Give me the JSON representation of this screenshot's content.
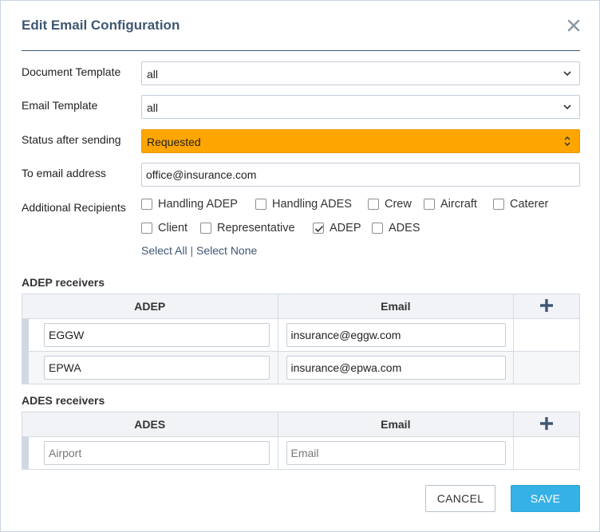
{
  "dialog": {
    "title": "Edit Email Configuration",
    "close_icon": "close-icon"
  },
  "form": {
    "document_template": {
      "label": "Document Template",
      "value": "all"
    },
    "email_template": {
      "label": "Email Template",
      "value": "all"
    },
    "status_after_sending": {
      "label": "Status after sending",
      "value": "Requested",
      "color": "#ffa500"
    },
    "to_email": {
      "label": "To email address",
      "value": "office@insurance.com"
    },
    "additional_recipients": {
      "label": "Additional Recipients",
      "options": [
        {
          "label": "Handling ADEP",
          "checked": false
        },
        {
          "label": "Handling ADES",
          "checked": false
        },
        {
          "label": "Crew",
          "checked": false
        },
        {
          "label": "Aircraft",
          "checked": false
        },
        {
          "label": "Caterer",
          "checked": false
        },
        {
          "label": "Client",
          "checked": false
        },
        {
          "label": "Representative",
          "checked": false
        },
        {
          "label": "ADEP",
          "checked": true
        },
        {
          "label": "ADES",
          "checked": false
        }
      ],
      "select_all": "Select All",
      "separator": "|",
      "select_none": "Select None"
    }
  },
  "adep_receivers": {
    "title": "ADEP receivers",
    "columns": [
      "ADEP",
      "Email"
    ],
    "add_icon": "plus-icon",
    "rows": [
      {
        "airport": "EGGW",
        "email": "insurance@eggw.com"
      },
      {
        "airport": "EPWA",
        "email": "insurance@epwa.com"
      }
    ]
  },
  "ades_receivers": {
    "title": "ADES receivers",
    "columns": [
      "ADES",
      "Email"
    ],
    "add_icon": "plus-icon",
    "rows": [
      {
        "airport": "",
        "email": "",
        "airport_placeholder": "Airport",
        "email_placeholder": "Email"
      }
    ]
  },
  "footer": {
    "cancel_label": "CANCEL",
    "save_label": "SAVE",
    "save_color": "#36b1e6"
  }
}
